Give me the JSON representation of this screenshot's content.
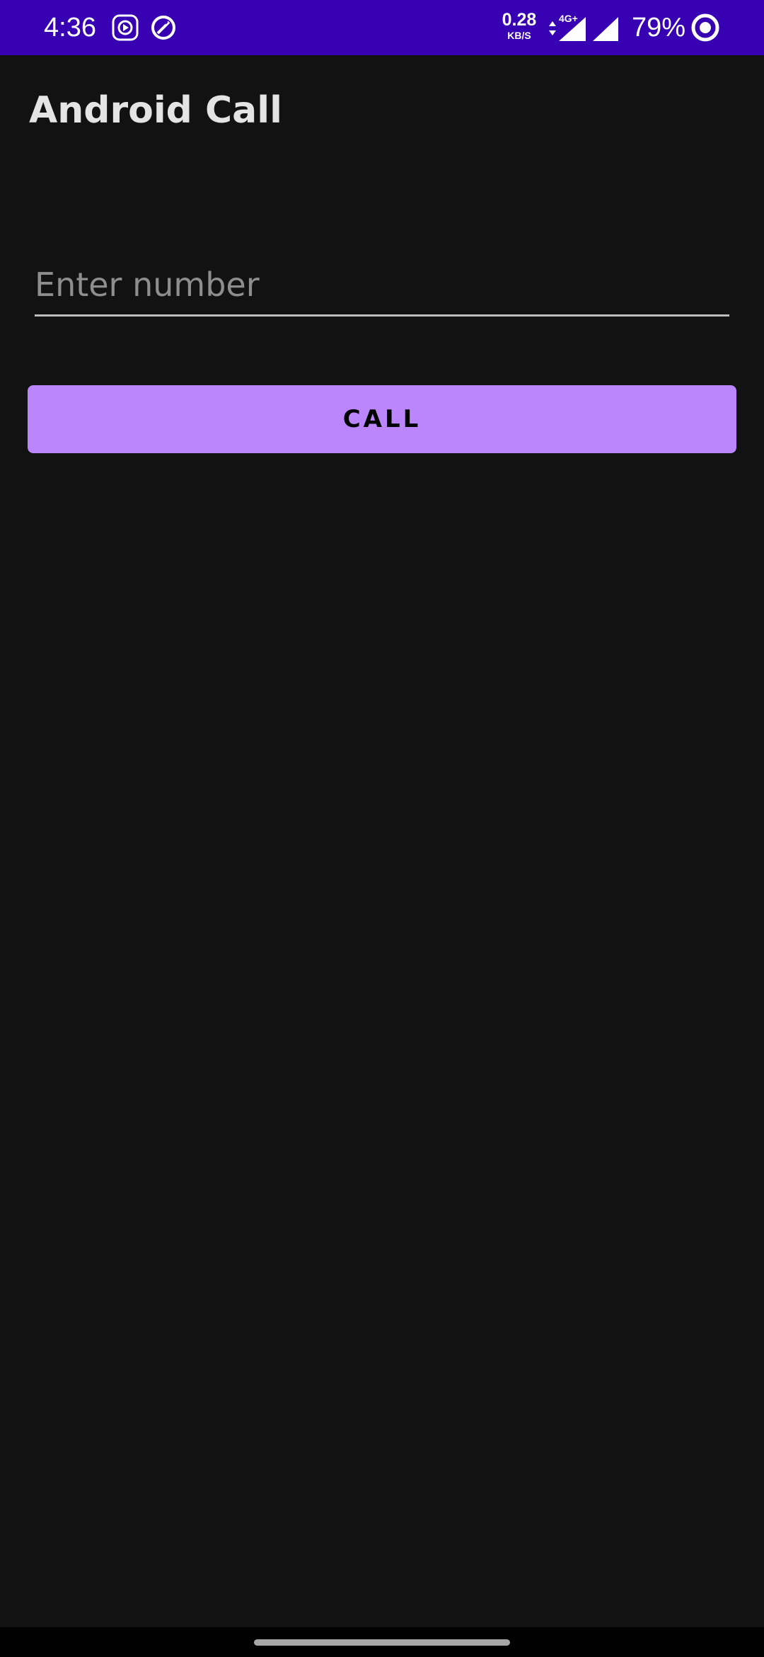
{
  "status_bar": {
    "time": "4:36",
    "network_speed_value": "0.28",
    "network_speed_unit": "KB/S",
    "network_type": "4G+",
    "battery_percent": "79%",
    "background_color": "#3700b3"
  },
  "app": {
    "title": "Android Call"
  },
  "form": {
    "number_placeholder": "Enter number",
    "number_value": "",
    "call_button_label": "CALL",
    "accent_color": "#bb86fc"
  },
  "icons": {
    "status_left": [
      "media-player-notification-icon",
      "data-saver-icon"
    ],
    "status_right": [
      "data-arrows-icon",
      "mobile-signal-icon",
      "cellular-signal-icon",
      "battery-icon"
    ]
  }
}
